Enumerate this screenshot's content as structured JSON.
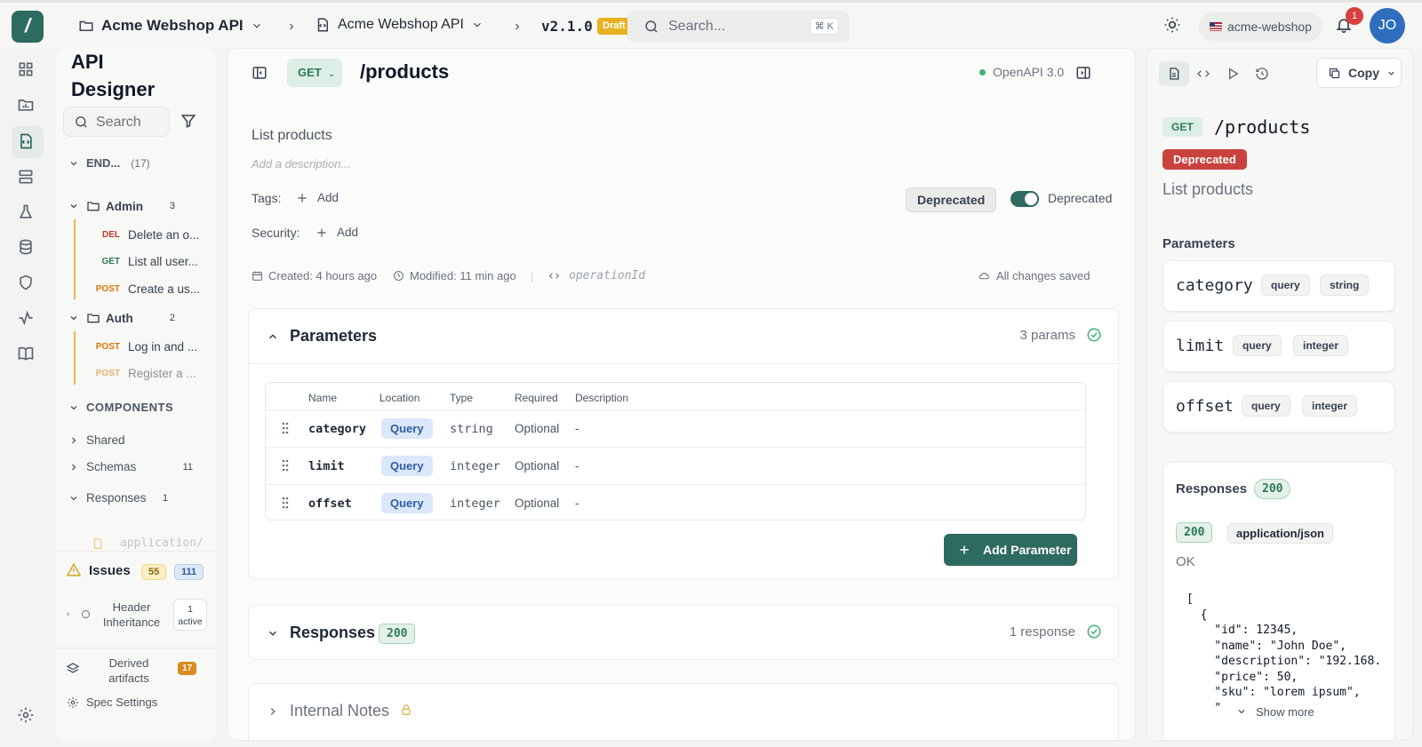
{
  "topbar": {
    "project": "Acme Webshop API",
    "api": "Acme Webshop API",
    "version": "v2.1.0",
    "version_badge": "Draft",
    "search_placeholder": "Search...",
    "search_shortcut": "⌘ K",
    "org": "acme-webshop",
    "notifications": "1",
    "avatar_initials": "JO"
  },
  "left": {
    "title": "API Designer",
    "search_placeholder": "Search",
    "endpoints_label": "END...",
    "endpoints_count": "(17)",
    "groups": [
      {
        "name": "Admin",
        "count": "3",
        "items": [
          {
            "verb": "DEL",
            "label": "Delete an o..."
          },
          {
            "verb": "GET",
            "label": "List all user..."
          },
          {
            "verb": "POST",
            "label": "Create a us..."
          }
        ]
      },
      {
        "name": "Auth",
        "count": "2",
        "items": [
          {
            "verb": "POST",
            "label": "Log in and ..."
          },
          {
            "verb": "POST",
            "label": "Register a ..."
          }
        ]
      }
    ],
    "components_label": "COMPONENTS",
    "components": [
      {
        "label": "Shared",
        "count": ""
      },
      {
        "label": "Schemas",
        "count": "11"
      },
      {
        "label": "Responses",
        "count": "1"
      }
    ],
    "partial_item": "application/",
    "issues_label": "Issues",
    "issues_warn": "55",
    "issues_info": "111",
    "header_inheritance": "Header Inheritance",
    "header_active": "1 active",
    "derived_artifacts": "Derived artifacts",
    "derived_count": "17",
    "spec_settings": "Spec Settings"
  },
  "main": {
    "method": "GET",
    "path": "/products",
    "openapi": "OpenAPI 3.0",
    "summary": "List products",
    "description_placeholder": "Add a description...",
    "tags_label": "Tags:",
    "security_label": "Security:",
    "add_label": "Add",
    "deprecated_badge": "Deprecated",
    "deprecated_toggle_label": "Deprecated",
    "created": "Created: 4 hours ago",
    "modified": "Modified: 11 min ago",
    "operation_id": "operationId",
    "saved": "All changes saved",
    "parameters": {
      "title": "Parameters",
      "count": "3 params",
      "headers": [
        "Name",
        "Location",
        "Type",
        "Required",
        "Description"
      ],
      "rows": [
        {
          "name": "category",
          "location": "Query",
          "type": "string",
          "required": "Optional",
          "description": "-"
        },
        {
          "name": "limit",
          "location": "Query",
          "type": "integer",
          "required": "Optional",
          "description": "-"
        },
        {
          "name": "offset",
          "location": "Query",
          "type": "integer",
          "required": "Optional",
          "description": "-"
        }
      ],
      "add_button": "Add Parameter"
    },
    "responses": {
      "title": "Responses",
      "code": "200",
      "count": "1 response"
    },
    "internal_notes": "Internal Notes"
  },
  "right": {
    "copy_label": "Copy",
    "method": "GET",
    "path": "/products",
    "deprecated": "Deprecated",
    "summary": "List products",
    "parameters_label": "Parameters",
    "params": [
      {
        "name": "category",
        "location": "query",
        "type": "string"
      },
      {
        "name": "limit",
        "location": "query",
        "type": "integer"
      },
      {
        "name": "offset",
        "location": "query",
        "type": "integer"
      }
    ],
    "responses_label": "Responses",
    "responses_code": "200",
    "status": "200",
    "content_type": "application/json",
    "status_text": "OK",
    "example": "[\n  {\n    \"id\": 12345,\n    \"name\": \"John Doe\",\n    \"description\": \"192.168.\n    \"price\": 50,\n    \"sku\": \"lorem ipsum\",\n    \"",
    "show_more": "Show more"
  },
  "colors": {
    "brand": "#2d6a5f",
    "get": "#2d7a57",
    "post": "#d97706",
    "delete": "#c0392b",
    "deprecated": "#c9423d",
    "draft": "#e6b21f"
  }
}
